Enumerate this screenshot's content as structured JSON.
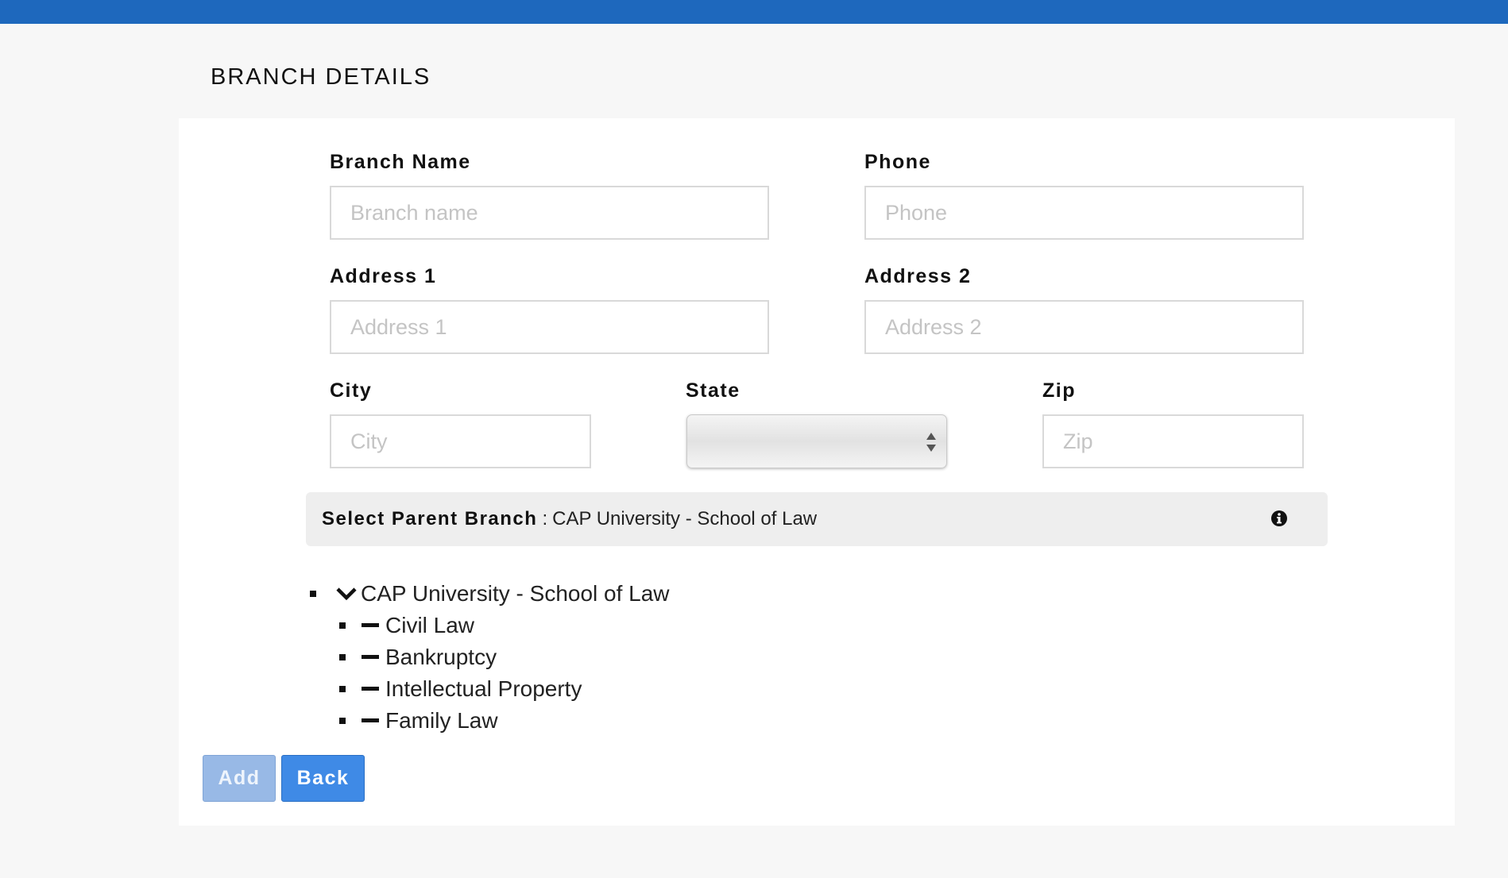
{
  "page": {
    "title": "BRANCH DETAILS"
  },
  "form": {
    "branch_name": {
      "label": "Branch Name",
      "placeholder": "Branch name",
      "value": ""
    },
    "phone": {
      "label": "Phone",
      "placeholder": "Phone",
      "value": ""
    },
    "address1": {
      "label": "Address 1",
      "placeholder": "Address 1",
      "value": ""
    },
    "address2": {
      "label": "Address 2",
      "placeholder": "Address 2",
      "value": ""
    },
    "city": {
      "label": "City",
      "placeholder": "City",
      "value": ""
    },
    "state": {
      "label": "State",
      "selected": ""
    },
    "zip": {
      "label": "Zip",
      "placeholder": "Zip",
      "value": ""
    }
  },
  "parent_branch": {
    "label": "Select Parent Branch",
    "separator": ":",
    "value": "CAP University - School of Law",
    "icon": "info-icon"
  },
  "tree": {
    "root": {
      "label": "CAP University - School of Law",
      "icon": "chevron-down-icon",
      "expanded": true
    },
    "children": [
      {
        "label": "Civil Law",
        "icon": "minus-icon"
      },
      {
        "label": "Bankruptcy",
        "icon": "minus-icon"
      },
      {
        "label": "Intellectual Property",
        "icon": "minus-icon"
      },
      {
        "label": "Family Law",
        "icon": "minus-icon"
      }
    ]
  },
  "actions": {
    "add_label": "Add",
    "back_label": "Back"
  },
  "colors": {
    "top_bar": "#1e68bd",
    "add_button": "#98b9e6",
    "back_button": "#3f8ae6"
  }
}
